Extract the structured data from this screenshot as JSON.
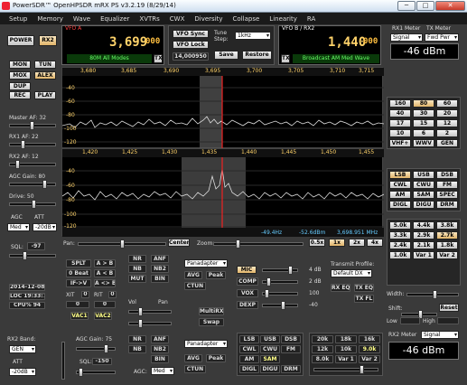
{
  "window": {
    "title": "PowerSDR™ OpenHPSDR mRX PS v3.2.19 (8/29/14)",
    "controls": [
      "─",
      "□",
      "✕"
    ]
  },
  "menu": [
    "Setup",
    "Memory",
    "Wave",
    "Equalizer",
    "XVTRs",
    "CWX",
    "Diversity",
    "Collapse",
    "Linearity",
    "RA"
  ],
  "left": {
    "power": "POWER",
    "rx2": "RX2",
    "mon": "MON",
    "tun": "TUN",
    "mox": "MOX",
    "alex": "ALEX",
    "dup": "DUP",
    "rec": "REC",
    "play": "PLAY",
    "master_af": "Master AF:  32",
    "rx1_af": "RX1 AF:  22",
    "rx2_af": "RX2 AF:  12",
    "agc_gain": "AGC Gain:  80",
    "drive": "Drive:  50",
    "agc": "AGC",
    "att": "ATT",
    "agc_val": "Med",
    "att_val": "-20dB",
    "sql": "SQL:",
    "sql_val": "-97",
    "date": "2014-12-08",
    "loc": "LOC 19:33:14",
    "cpu": "CPU%  94",
    "rx2band": "RX2 Band:",
    "gen": "GEN",
    "att2": "ATT",
    "att2_val": "-20dB",
    "vol": "V\nO\nL"
  },
  "vfoa": {
    "label": "VFO A",
    "freq": "3,699",
    "sub": "000",
    "mode": "80M All Modes",
    "tx": "TX"
  },
  "vfo_mid": {
    "sync": "VFO Sync",
    "lock": "VFO Lock",
    "tune_step": "Tune Step:",
    "step": "1kHz",
    "val": "14,000950",
    "save": "Save",
    "restore": "Restore"
  },
  "vfob": {
    "label": "VFO B / RX2",
    "freq": "1,440",
    "sub": "000",
    "mode": "Broadcast AM Med Wave",
    "tx": "TX"
  },
  "right_meters": {
    "rx1_meter": "RX1 Meter",
    "tx_meter": "TX Meter",
    "signal": "Signal",
    "fwd": "Fwd Pwr",
    "dbm": "-46 dBm",
    "rx2_meter": "RX2 Meter",
    "signal2": "Signal",
    "dbm2": "-46 dBm"
  },
  "pan1": {
    "ticks": [
      "3,680",
      "3,685",
      "3,690",
      "3,695",
      "3,700",
      "3,705",
      "3,710",
      "3,715"
    ],
    "db": [
      "-40",
      "-60",
      "-80",
      "-100",
      "-120"
    ]
  },
  "pan2": {
    "ticks": [
      "1,420",
      "1,425",
      "1,430",
      "1,435",
      "1,440",
      "1,445",
      "1,450",
      "1,455"
    ],
    "db": [
      "-40",
      "-60",
      "-80",
      "-100",
      "-120"
    ],
    "status": [
      "-49.4Hz",
      "-52.6dBm",
      "3,698.951 MHz"
    ]
  },
  "bands1": [
    "160",
    "80",
    "60",
    "40",
    "30",
    "20",
    "17",
    "15",
    "12",
    "10",
    "6",
    "2",
    "VHF+",
    "WWV",
    "GEN"
  ],
  "modes1": [
    "LSB",
    "USB",
    "DSB",
    "CWL",
    "CWU",
    "FM",
    "AM",
    "SAM",
    "SPEC",
    "DIGL",
    "DIGU",
    "DRM"
  ],
  "filters1": [
    "5.0k",
    "4.4k",
    "3.8k",
    "3.3k",
    "2.9k",
    "2.7k",
    "2.4k",
    "2.1k",
    "1.8k",
    "1.0k",
    "Var 1",
    "Var 2"
  ],
  "panbar": {
    "pan": "Pan:",
    "center": "Center",
    "zoom": "Zoom:",
    "z": [
      "0.5x",
      "1x",
      "2x",
      "4x"
    ]
  },
  "dsp": {
    "splt": "SPLT",
    "atob": "A > B",
    "beat": "0 Beat",
    "atob2": "A < B",
    "ifv": "IF->V",
    "asb": "A <> B",
    "xit": "XIT",
    "rit": "RIT",
    "zero": "0",
    "vac1": "VAC1",
    "vac2": "VAC2",
    "nr": "NR",
    "anf": "ANF",
    "nb": "NB",
    "nb2": "NB2",
    "mut": "MUT",
    "bin": "BIN",
    "pana": "Panadapter",
    "avg": "AVG",
    "peak": "Peak",
    "ctun": "CTUN",
    "multirx": "MultiRX",
    "swap": "Swap",
    "vol": "Vol",
    "pan": "Pan",
    "mic": "MIC",
    "comp": "COMP",
    "vox": "VOX",
    "dexp": "DEXP",
    "mic_v": "4 dB",
    "comp_v": "2 dB",
    "vox_v": "100",
    "dexp_v": "-40",
    "txprof": "Transmit Profile:",
    "prof": "Default DX",
    "rxeq": "RX EQ",
    "txeq": "TX EQ",
    "txfl": "TX FL",
    "width": "Width:",
    "shift": "Shift:",
    "reset": "Reset",
    "low": "Low",
    "high": "High"
  },
  "rx2": {
    "agcgain": "AGC Gain:  75",
    "sql": "SQL:",
    "sqlv": "-150",
    "agc": "AGC:",
    "agcv": "Med",
    "nr": "NR",
    "anf": "ANF",
    "nb": "NB",
    "nb2": "NB2",
    "bin": "BIN",
    "pana": "Panadapter",
    "avg": "AVG",
    "peak": "Peak",
    "ctun": "CTUN",
    "modes": [
      "LSB",
      "USB",
      "DSB",
      "CWL",
      "CWU",
      "FM",
      "AM",
      "SAM",
      "DIGL",
      "DIGU",
      "DRM"
    ],
    "filters": [
      "20k",
      "18k",
      "16k",
      "12k",
      "10k",
      "9.0k",
      "8.0k",
      "Var 1",
      "Var 2"
    ]
  }
}
